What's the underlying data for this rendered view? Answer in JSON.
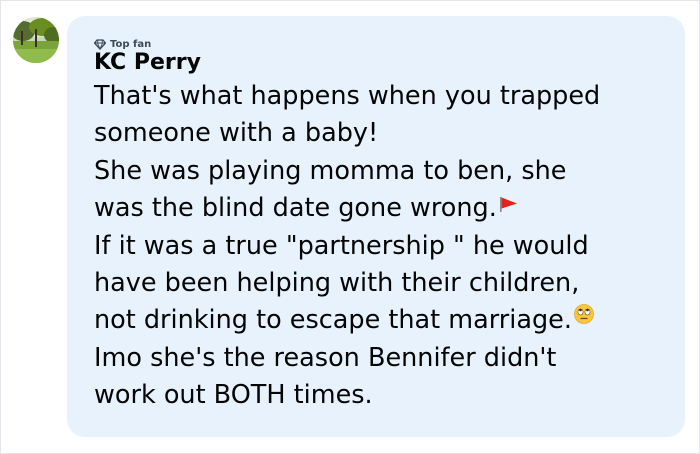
{
  "comment": {
    "badge": {
      "icon": "diamond-icon",
      "label": "Top fan"
    },
    "author": "KC Perry",
    "lines": [
      "That's what happens when you trapped",
      "someone with a baby!",
      "She was playing momma to ben, she",
      "was the blind date gone wrong.",
      "If it was a true \"partnership \" he would",
      "have been helping with their children,",
      "not drinking to escape that marriage.",
      "Imo she's the reason Bennifer didn't",
      "work out BOTH times."
    ],
    "emojis": {
      "line4": "red-flag-emoji",
      "line7": "eye-roll-emoji"
    }
  },
  "colors": {
    "bubble": "#e7f2fd",
    "text": "#050505",
    "badge_text": "#3d4a57",
    "flag": "#e0241b"
  }
}
